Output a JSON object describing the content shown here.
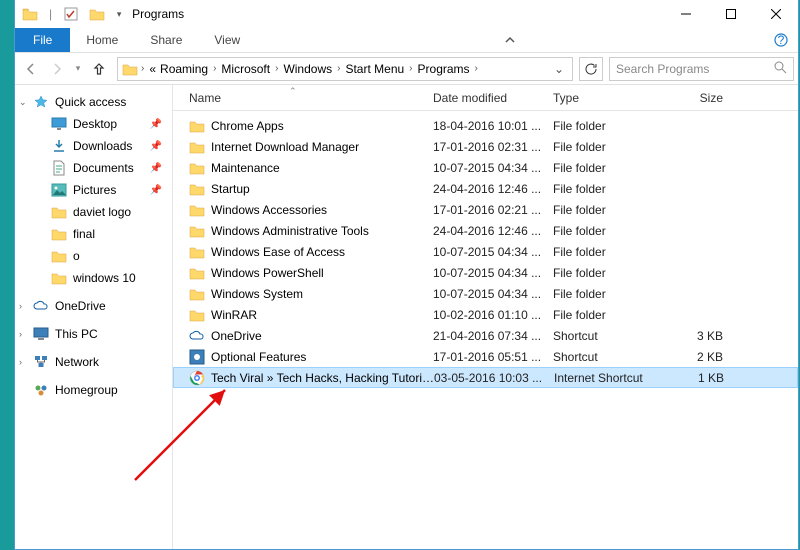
{
  "window": {
    "title": "Programs"
  },
  "ribbon": {
    "file": "File",
    "tabs": [
      "Home",
      "Share",
      "View"
    ]
  },
  "breadcrumbs": [
    "Roaming",
    "Microsoft",
    "Windows",
    "Start Menu",
    "Programs"
  ],
  "breadcrumb_prefix": "«",
  "search": {
    "placeholder": "Search Programs"
  },
  "sidebar": {
    "quick_access": "Quick access",
    "quick_items": [
      {
        "label": "Desktop",
        "icon": "desktop",
        "pin": true
      },
      {
        "label": "Downloads",
        "icon": "downloads",
        "pin": true
      },
      {
        "label": "Documents",
        "icon": "documents",
        "pin": true
      },
      {
        "label": "Pictures",
        "icon": "pictures",
        "pin": true
      },
      {
        "label": "daviet logo",
        "icon": "folder",
        "pin": false
      },
      {
        "label": "final",
        "icon": "folder",
        "pin": false
      },
      {
        "label": "o",
        "icon": "folder",
        "pin": false
      },
      {
        "label": "windows 10",
        "icon": "folder",
        "pin": false
      }
    ],
    "onedrive": "OneDrive",
    "thispc": "This PC",
    "network": "Network",
    "homegroup": "Homegroup"
  },
  "columns": {
    "name": "Name",
    "date": "Date modified",
    "type": "Type",
    "size": "Size"
  },
  "rows": [
    {
      "name": "Chrome Apps",
      "date": "18-04-2016 10:01 ...",
      "type": "File folder",
      "size": "",
      "icon": "folder"
    },
    {
      "name": "Internet Download Manager",
      "date": "17-01-2016 02:31 ...",
      "type": "File folder",
      "size": "",
      "icon": "folder"
    },
    {
      "name": "Maintenance",
      "date": "10-07-2015 04:34 ...",
      "type": "File folder",
      "size": "",
      "icon": "folder"
    },
    {
      "name": "Startup",
      "date": "24-04-2016 12:46 ...",
      "type": "File folder",
      "size": "",
      "icon": "folder"
    },
    {
      "name": "Windows Accessories",
      "date": "17-01-2016 02:21 ...",
      "type": "File folder",
      "size": "",
      "icon": "folder"
    },
    {
      "name": "Windows Administrative Tools",
      "date": "24-04-2016 12:46 ...",
      "type": "File folder",
      "size": "",
      "icon": "folder"
    },
    {
      "name": "Windows Ease of Access",
      "date": "10-07-2015 04:34 ...",
      "type": "File folder",
      "size": "",
      "icon": "folder"
    },
    {
      "name": "Windows PowerShell",
      "date": "10-07-2015 04:34 ...",
      "type": "File folder",
      "size": "",
      "icon": "folder"
    },
    {
      "name": "Windows System",
      "date": "10-07-2015 04:34 ...",
      "type": "File folder",
      "size": "",
      "icon": "folder"
    },
    {
      "name": "WinRAR",
      "date": "10-02-2016 01:10 ...",
      "type": "File folder",
      "size": "",
      "icon": "folder"
    },
    {
      "name": "OneDrive",
      "date": "21-04-2016 07:34 ...",
      "type": "Shortcut",
      "size": "3 KB",
      "icon": "onedrive"
    },
    {
      "name": "Optional Features",
      "date": "17-01-2016 05:51 ...",
      "type": "Shortcut",
      "size": "2 KB",
      "icon": "settings"
    },
    {
      "name": "Tech Viral » Tech Hacks, Hacking Tutoria...",
      "date": "03-05-2016 10:03 ...",
      "type": "Internet Shortcut",
      "size": "1 KB",
      "icon": "chrome",
      "selected": true
    }
  ]
}
